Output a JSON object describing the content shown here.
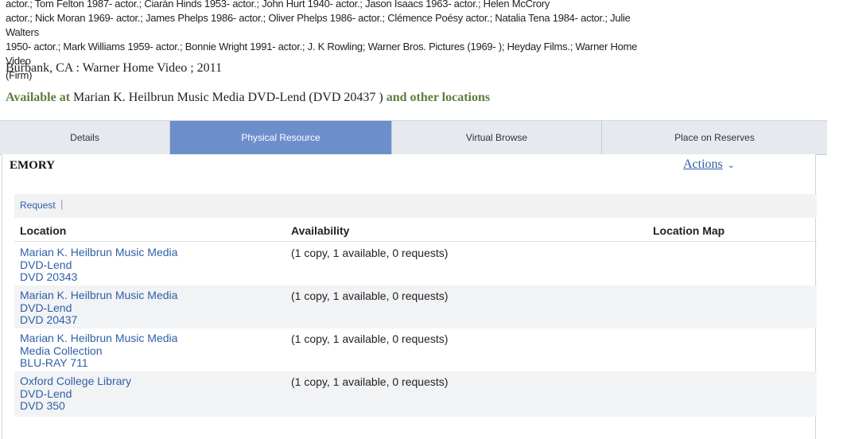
{
  "credits_lines": [
    "actor.; Tom Felton 1987- actor.; Ciarán Hinds 1953- actor.; John Hurt 1940- actor.; Jason Isaacs 1963- actor.; Helen McCrory",
    "actor.; Nick Moran 1969- actor.; James Phelps 1986- actor.; Oliver Phelps 1986- actor.; Clémence Poésy actor.; Natalia Tena 1984- actor.; Julie Walters",
    "1950- actor.; Mark Williams 1959- actor.; Bonnie Wright 1991- actor.; J. K Rowling; Warner Bros. Pictures (1969- ); Heyday Films.; Warner Home Video",
    "(Firm)"
  ],
  "publication": "Burbank, CA : Warner Home Video ; 2011",
  "availability": {
    "prefix": "Available at",
    "location": "Marian K. Heilbrun Music Media DVD-Lend (DVD 20437 )",
    "suffix": "and other locations"
  },
  "tabs": [
    {
      "label": "Details",
      "active": false
    },
    {
      "label": "Physical Resource",
      "active": true
    },
    {
      "label": "Virtual Browse",
      "active": false
    },
    {
      "label": "Place on Reserves",
      "active": false
    }
  ],
  "panel": {
    "org": "EMORY",
    "actions_label": "Actions",
    "request_label": "Request",
    "request_sep": "|",
    "columns": {
      "location": "Location",
      "availability": "Availability",
      "map": "Location Map"
    },
    "rows": [
      {
        "loc1": "Marian K. Heilbrun Music Media",
        "loc2": "DVD-Lend",
        "loc3": "DVD 20343",
        "avail": "(1 copy, 1 available, 0 requests)"
      },
      {
        "loc1": "Marian K. Heilbrun Music Media",
        "loc2": "DVD-Lend",
        "loc3": "DVD 20437",
        "avail": "(1 copy, 1 available, 0 requests)"
      },
      {
        "loc1": "Marian K. Heilbrun Music Media",
        "loc2": "Media Collection",
        "loc3": "BLU-RAY 711",
        "avail": "(1 copy, 1 available, 0 requests)"
      },
      {
        "loc1": "Oxford College Library",
        "loc2": "DVD-Lend",
        "loc3": "DVD 350",
        "avail": "(1 copy, 1 available, 0 requests)"
      }
    ]
  },
  "colors": {
    "accent_tab": "#6c8fcc",
    "link": "#2f5fa6",
    "available_green": "#5a7f3c"
  }
}
